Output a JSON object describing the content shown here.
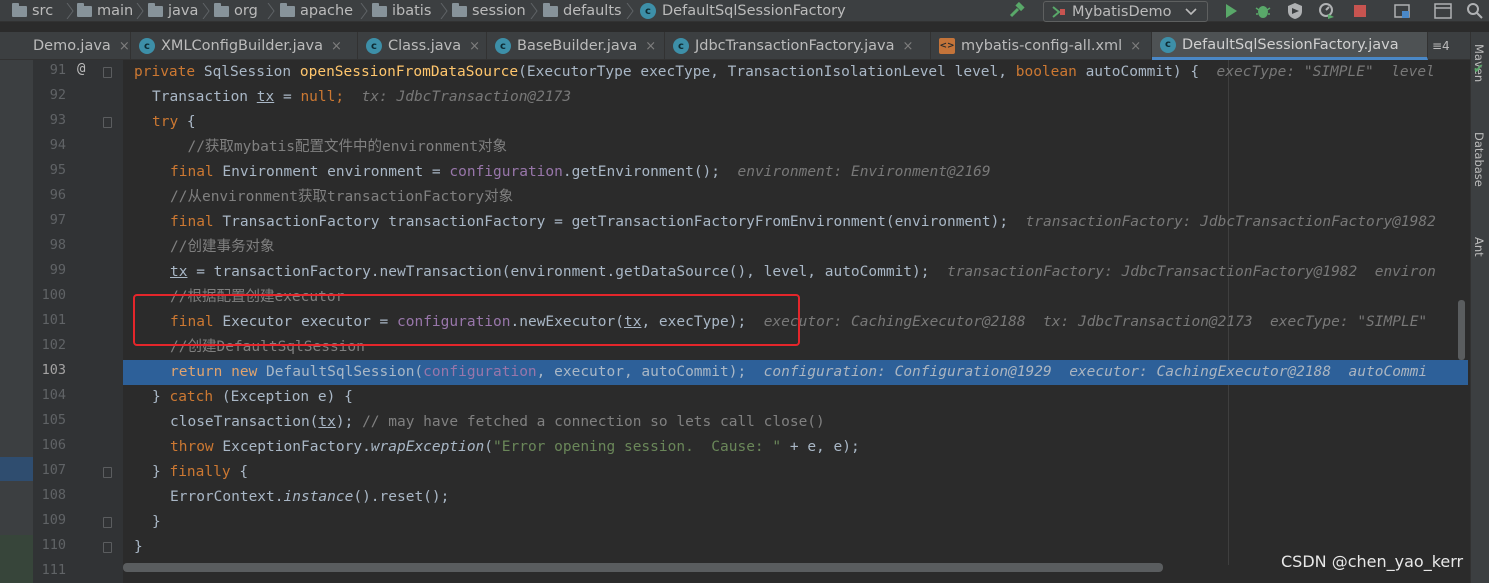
{
  "breadcrumbs": [
    "src",
    "main",
    "java",
    "org",
    "apache",
    "ibatis",
    "session",
    "defaults",
    "DefaultSqlSessionFactory"
  ],
  "run_config": {
    "label": "MybatisDemo"
  },
  "tabs": [
    {
      "label": "Demo.java",
      "icon": "class-icon",
      "close": "×"
    },
    {
      "label": "XMLConfigBuilder.java",
      "icon": "class-icon",
      "close": "×"
    },
    {
      "label": "Class.java",
      "icon": "class-icon",
      "close": "×"
    },
    {
      "label": "BaseBuilder.java",
      "icon": "class-icon",
      "close": "×"
    },
    {
      "label": "JdbcTransactionFactory.java",
      "icon": "class-icon",
      "close": "×"
    },
    {
      "label": "mybatis-config-all.xml",
      "icon": "xml-icon",
      "close": "×"
    },
    {
      "label": "DefaultSqlSessionFactory.java",
      "icon": "class-icon",
      "close": ""
    }
  ],
  "tab_overflow": "≡4",
  "side_tools": [
    "Maven",
    "Database",
    "Ant"
  ],
  "line_numbers": [
    "91",
    "92",
    "93",
    "94",
    "95",
    "96",
    "97",
    "98",
    "99",
    "100",
    "101",
    "102",
    "103",
    "104",
    "105",
    "106",
    "107",
    "108",
    "109",
    "110",
    "111"
  ],
  "current_line": "103",
  "code": {
    "l91": {
      "t1": "private ",
      "t2": "SqlSession ",
      "t3": "openSessionFromDataSource",
      "t4": "(ExecutorType execType, TransactionIsolationLevel level, ",
      "t5": "boolean ",
      "t6": "autoCommit) {",
      "hint": "execType: \"SIMPLE\"  level"
    },
    "l92": {
      "t1": "Transaction ",
      "t2": "tx",
      "t3": " = ",
      "t4": "null",
      "t5": ";",
      "hint": "tx: JdbcTransaction@2173"
    },
    "l93": {
      "t1": "try",
      "t2": " {"
    },
    "l94": {
      "t1": "  //获取mybatis配置文件中的environment对象"
    },
    "l95": {
      "t1": "final ",
      "t2": "Environment environment = ",
      "t3": "configuration",
      "t4": ".getEnvironment();",
      "hint": "environment: Environment@2169"
    },
    "l96": {
      "t1": "//从environment获取transactionFactory对象"
    },
    "l97": {
      "t1": "final ",
      "t2": "TransactionFactory transactionFactory = getTransactionFactoryFromEnvironment(environment);",
      "hint": "transactionFactory: JdbcTransactionFactory@1982"
    },
    "l98": {
      "t1": "//创建事务对象"
    },
    "l99": {
      "t1": "tx",
      "t2": " = transactionFactory.newTransaction(environment.getDataSource(), level, autoCommit);",
      "hint": "transactionFactory: JdbcTransactionFactory@1982  environ"
    },
    "l100": {
      "t1": "//根据配置创建executor"
    },
    "l101": {
      "t1": "final ",
      "t2": "Executor executor = ",
      "t3": "configuration",
      "t4": ".newExecutor(",
      "t5": "tx",
      "t6": ", execType);",
      "hint": "executor: CachingExecutor@2188  tx: JdbcTransaction@2173  execType: \"SIMPLE\""
    },
    "l102": {
      "t1": "//创建DefaultSqlSession"
    },
    "l103": {
      "t1": "return new ",
      "t2": "DefaultSqlSession(",
      "t3": "configuration",
      "t4": ", executor, autoCommit);",
      "hint": "configuration: Configuration@1929  executor: CachingExecutor@2188  autoCommi"
    },
    "l104": {
      "t1": "} ",
      "t2": "catch ",
      "t3": "(Exception e) {"
    },
    "l105": {
      "t1": "closeTransaction(",
      "t2": "tx",
      "t3": "); ",
      "t4": "// may have fetched a connection so lets call close()"
    },
    "l106": {
      "t1": "throw ",
      "t2": "ExceptionFactory.",
      "t3": "wrapException",
      "t4": "(",
      "t5": "\"Error opening session.  Cause: \"",
      "t6": " + e, e);"
    },
    "l107": {
      "t1": "} ",
      "t2": "finally ",
      "t3": "{"
    },
    "l108": {
      "t1": "ErrorContext.",
      "t2": "instance",
      "t3": "().reset();"
    },
    "l109": {
      "t1": "}"
    },
    "l110": {
      "t1": "}"
    }
  },
  "watermark": "CSDN @chen_yao_kerr",
  "colors": {
    "keyword": "#cc7832",
    "field": "#9876aa",
    "method": "#ffc66d",
    "string": "#6a8759",
    "comment": "#808080",
    "execution_line": "#2d6099",
    "annotation_box": "#e4262b"
  }
}
